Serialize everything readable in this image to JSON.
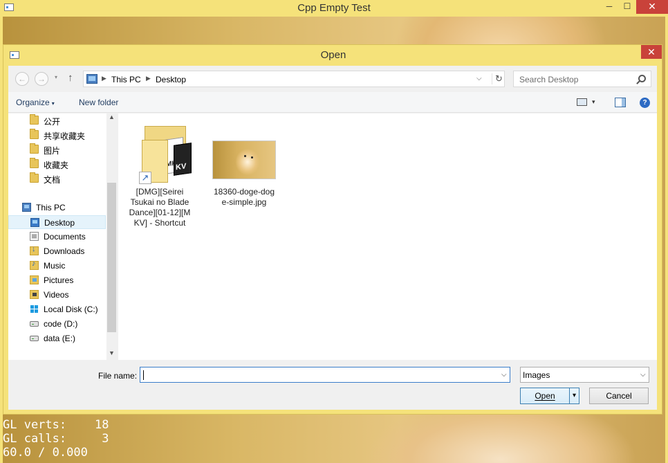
{
  "app": {
    "title": "Cpp Empty Test",
    "minimize": "─",
    "maximize": "☐",
    "close": "✕"
  },
  "gl_stats": {
    "verts_line": "GL verts:    18",
    "calls_line": "GL calls:     3",
    "fps_line": "60.0 / 0.000"
  },
  "dialog": {
    "title": "Open",
    "close": "✕",
    "nav": {
      "back": "←",
      "forward": "→",
      "recent": "▾",
      "up": "↑"
    },
    "address": {
      "crumbs": [
        "This PC",
        "Desktop"
      ],
      "sep": "▶",
      "dropdown": "⌵",
      "refresh": "↻"
    },
    "search": {
      "placeholder": "Search Desktop"
    },
    "toolbar": {
      "organize": "Organize",
      "new_folder": "New folder",
      "caret": "▾",
      "help": "?"
    },
    "nav_pane": {
      "items": [
        {
          "label": "公开",
          "icon": "folder-icon"
        },
        {
          "label": "共享收藏夹",
          "icon": "folder-icon"
        },
        {
          "label": "图片",
          "icon": "folder-icon"
        },
        {
          "label": "收藏夹",
          "icon": "folder-icon"
        },
        {
          "label": "文档",
          "icon": "folder-icon"
        },
        {
          "label": "This PC",
          "icon": "computer-icon"
        },
        {
          "label": "Desktop",
          "icon": "desktop-icon",
          "selected": true
        },
        {
          "label": "Documents",
          "icon": "documents-icon"
        },
        {
          "label": "Downloads",
          "icon": "downloads-icon"
        },
        {
          "label": "Music",
          "icon": "music-icon"
        },
        {
          "label": "Pictures",
          "icon": "pictures-icon"
        },
        {
          "label": "Videos",
          "icon": "videos-icon"
        },
        {
          "label": "Local Disk (C:)",
          "icon": "windows-drive-icon"
        },
        {
          "label": "code (D:)",
          "icon": "drive-icon"
        },
        {
          "label": "data (E:)",
          "icon": "drive-icon"
        }
      ],
      "scroll_up": "▲",
      "scroll_down": "▼"
    },
    "files": [
      {
        "name_lines": [
          "[DMG][Seirei",
          "Tsukai no Blade",
          "Dance][01-12][M",
          "KV] - Shortcut"
        ],
        "icon": "mkv-folder-shortcut-icon",
        "card1": "MKV",
        "card2": "KV",
        "shortcut_arrow": "↗"
      },
      {
        "name_lines": [
          "18360-doge-dog",
          "e-simple.jpg"
        ],
        "icon": "doge-thumbnail"
      }
    ],
    "file_name": {
      "label": "File name:",
      "value": "",
      "dropdown": "⌵"
    },
    "file_type": {
      "selected": "Images",
      "dropdown": "⌵"
    },
    "buttons": {
      "open": "Open",
      "open_split": "▾",
      "cancel": "Cancel"
    }
  }
}
